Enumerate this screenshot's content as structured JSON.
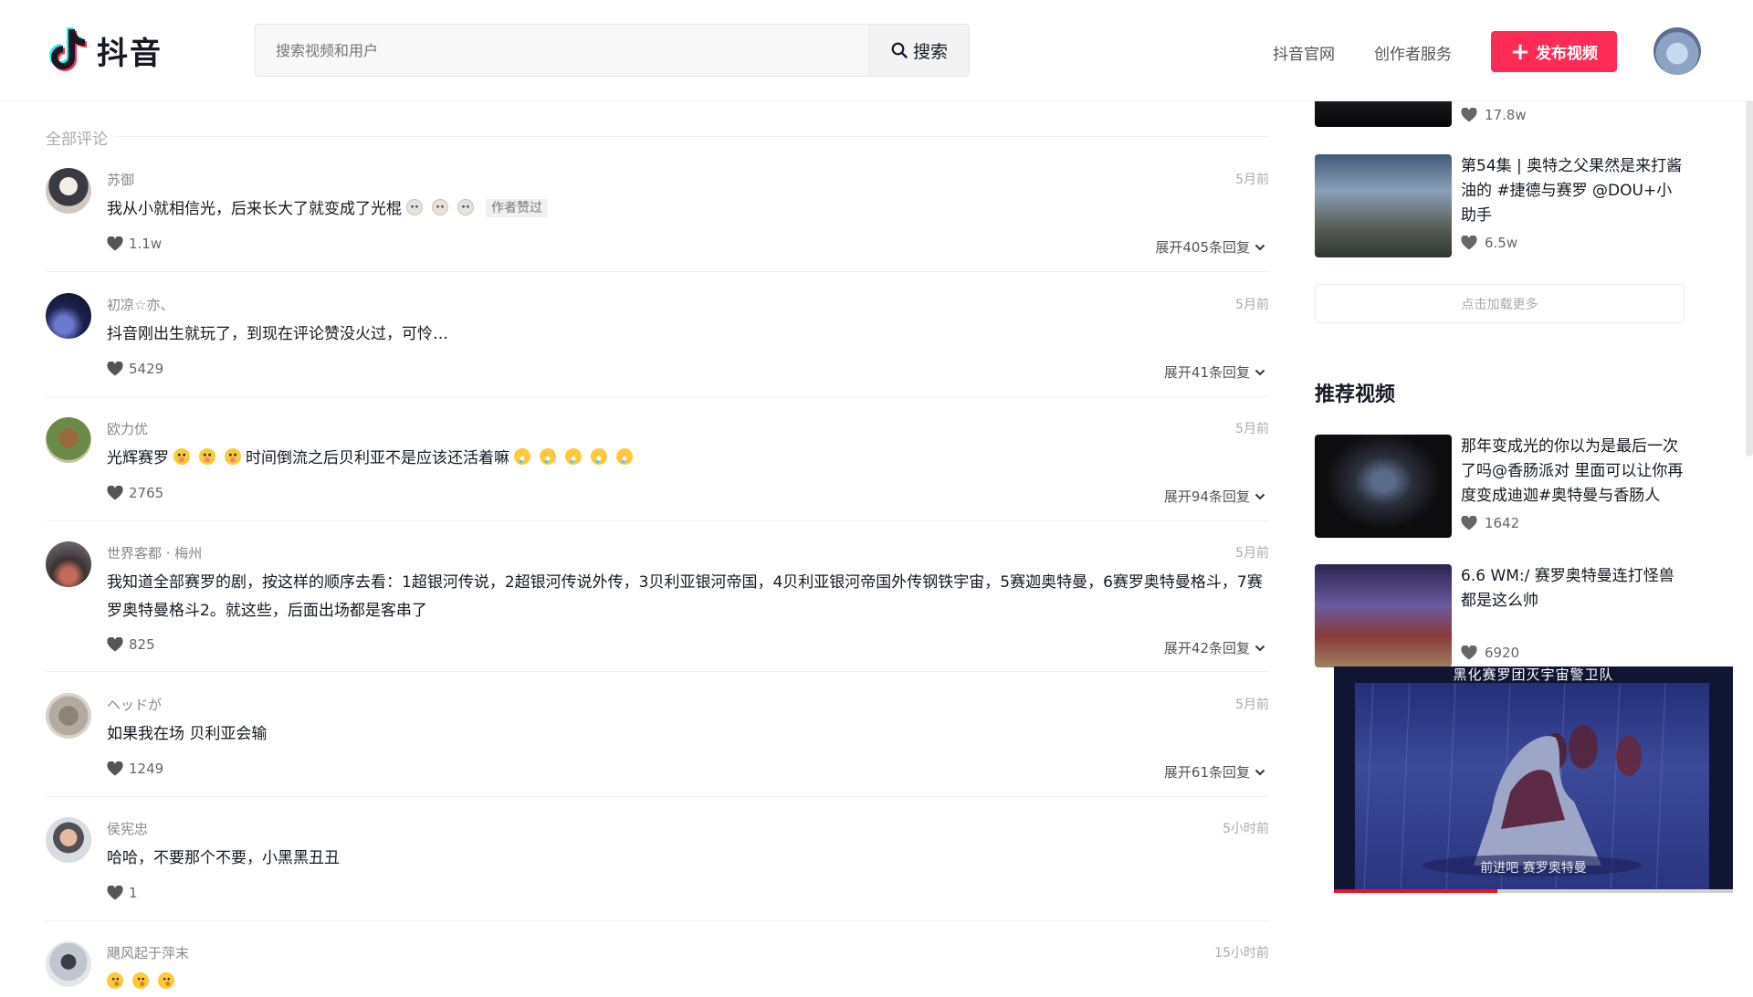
{
  "header": {
    "logo_text": "抖音",
    "search_placeholder": "搜索视频和用户",
    "search_button": "搜索",
    "nav": [
      "抖音官网",
      "创作者服务"
    ],
    "publish_button": "发布视频"
  },
  "comments": {
    "title": "全部评论",
    "items": [
      {
        "user": "苏御",
        "time": "5月前",
        "text": "我从小就相信光，后来长大了就变成了光棍",
        "emoji": [
          "cat-icon",
          "cat-icon",
          "cat-icon"
        ],
        "badge": "作者赞过",
        "likes": "1.1w",
        "expand": "展开405条回复"
      },
      {
        "user": "初凉☆亦、",
        "time": "5月前",
        "text": "抖音刚出生就玩了，到现在评论赞没火过，可怜…",
        "likes": "5429",
        "expand": "展开41条回复"
      },
      {
        "user": "欧力优",
        "time": "5月前",
        "text_before": "光辉赛罗",
        "emoji_before": [
          "yum-icon",
          "yum-icon",
          "yum-icon"
        ],
        "text": "时间倒流之后贝利亚不是应该还活着嘛",
        "emoji": [
          "rofl-icon",
          "rofl-icon",
          "rofl-icon",
          "rofl-icon",
          "rofl-icon"
        ],
        "likes": "2765",
        "expand": "展开94条回复"
      },
      {
        "user": "世界客都 · 梅州",
        "time": "5月前",
        "text": "我知道全部赛罗的剧，按这样的顺序去看：1超银河传说，2超银河传说外传，3贝利亚银河帝国，4贝利亚银河帝国外传钢铁宇宙，5赛迦奥特曼，6赛罗奥特曼格斗，7赛罗奥特曼格斗2。就这些，后面出场都是客串了",
        "likes": "825",
        "expand": "展开42条回复"
      },
      {
        "user": "ヘッドが",
        "time": "5月前",
        "text": "如果我在场 贝利亚会输",
        "likes": "1249",
        "expand": "展开61条回复"
      },
      {
        "user": "侯宪忠",
        "time": "5小时前",
        "text": "哈哈，不要那个不要，小黑黑丑丑",
        "likes": "1",
        "expand": ""
      },
      {
        "user": "飓风起于萍末",
        "time": "15小时前",
        "text": "",
        "emoji": [
          "think-icon",
          "think-icon",
          "think-icon"
        ],
        "likes": "",
        "expand": ""
      }
    ]
  },
  "sidebar": {
    "top_partial_likes": "17.8w",
    "videos": [
      {
        "title": "第54集 | 奥特之父果然是来打酱油的 #捷德与赛罗 @DOU+小助手",
        "likes": "6.5w"
      }
    ],
    "load_more": "点击加载更多",
    "recommend_title": "推荐视频",
    "recommended": [
      {
        "title": "那年变成光的你以为是最后一次了吗@香肠派对 里面可以让你再度变成迪迦#奥特曼与香肠人",
        "likes": "1642"
      },
      {
        "title": "6.6 WM:/ 赛罗奥特曼连打怪兽都是这么帅",
        "likes": "6920"
      }
    ]
  },
  "mini_player": {
    "caption_top": "黑化赛罗团灭宇宙警卫队",
    "caption_bottom": "前进吧 赛罗奥特曼",
    "progress": 0.41
  },
  "colors": {
    "accent": "#fe2c55",
    "progress": "#e2162a"
  }
}
